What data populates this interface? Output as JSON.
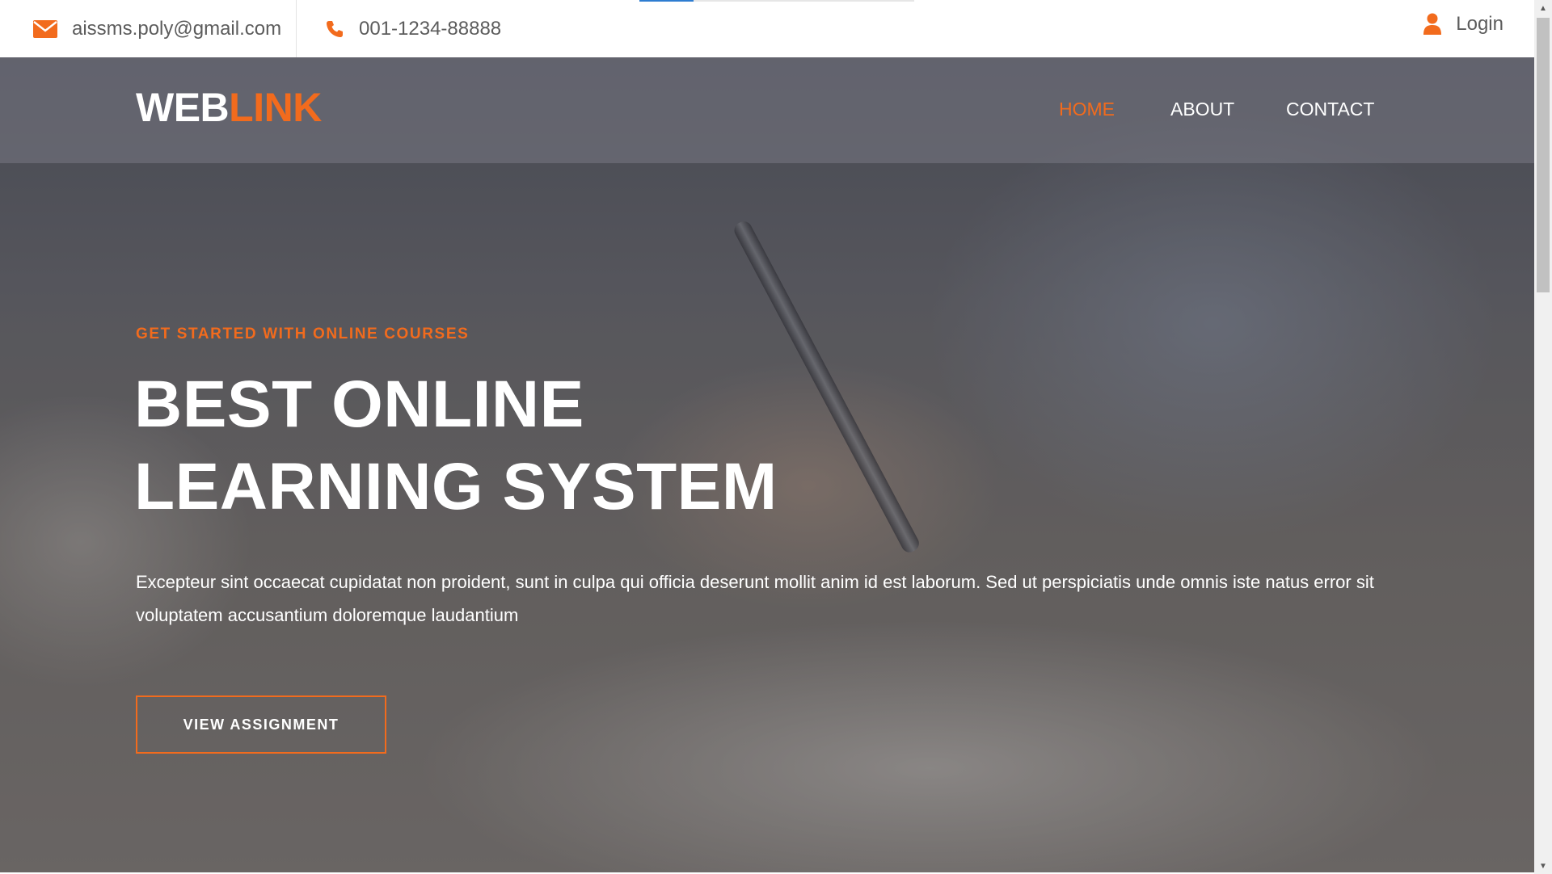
{
  "topbar": {
    "email": "aissms.poly@gmail.com",
    "phone": "001-1234-88888",
    "login": "Login"
  },
  "brand": {
    "part1": "WEB",
    "part2": "LINK"
  },
  "nav": {
    "home": "HOME",
    "about": "ABOUT",
    "contact": "CONTACT"
  },
  "hero": {
    "kicker": "GET STARTED WITH ONLINE COURSES",
    "headline_line1": "BEST ONLINE",
    "headline_line2": "LEARNING SYSTEM",
    "description": "Excepteur sint occaecat cupidatat non proident, sunt in culpa qui officia deserunt mollit anim id est laborum. Sed ut perspiciatis unde omnis iste natus error sit voluptatem accusantium doloremque laudantium",
    "cta": "VIEW ASSIGNMENT"
  },
  "colors": {
    "accent": "#f26b1d",
    "text_white": "#ffffff",
    "top_text": "#5c5c5c"
  },
  "icons": {
    "email": "envelope-icon",
    "phone": "phone-icon",
    "login": "user-icon"
  }
}
